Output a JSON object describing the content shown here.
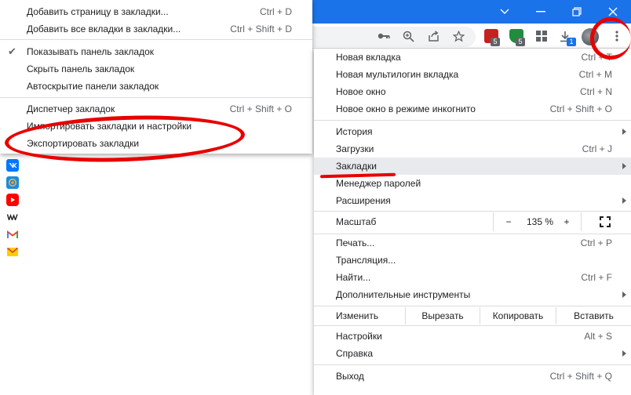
{
  "bookmarks_submenu": {
    "items": [
      {
        "label": "Добавить страницу в закладки...",
        "shortcut": "Ctrl + D"
      },
      {
        "label": "Добавить все вкладки в закладки...",
        "shortcut": "Ctrl + Shift + D"
      },
      {
        "label": "Показывать панель закладок",
        "shortcut": "",
        "checked": true
      },
      {
        "label": "Скрыть панель закладок",
        "shortcut": ""
      },
      {
        "label": "Автоскрытие панели закладок",
        "shortcut": ""
      },
      {
        "label": "Диспетчер закладок",
        "shortcut": "Ctrl + Shift + O"
      },
      {
        "label": "Импортировать закладки и настройки",
        "shortcut": ""
      },
      {
        "label": "Экспортировать закладки",
        "shortcut": ""
      }
    ],
    "check_glyph": "✔"
  },
  "bookmark_icons": [
    "vk-icon",
    "mail-ru-icon",
    "youtube-icon",
    "wildberries-icon",
    "gmail-icon",
    "yandex-mail-icon"
  ],
  "extensions": {
    "badge_1": "5",
    "badge_2": "5",
    "badge_3": "1"
  },
  "main_menu": {
    "new_tab": {
      "label": "Новая вкладка",
      "shortcut": "Ctrl + T"
    },
    "new_multilogin": {
      "label": "Новая мультилогин вкладка",
      "shortcut": "Ctrl + M"
    },
    "new_window": {
      "label": "Новое окно",
      "shortcut": "Ctrl + N"
    },
    "incognito": {
      "label": "Новое окно в режиме инкогнито",
      "shortcut": "Ctrl + Shift + O"
    },
    "history": {
      "label": "История",
      "shortcut": ""
    },
    "downloads": {
      "label": "Загрузки",
      "shortcut": "Ctrl + J"
    },
    "bookmarks": {
      "label": "Закладки",
      "shortcut": ""
    },
    "passwords": {
      "label": "Менеджер паролей",
      "shortcut": ""
    },
    "extensions": {
      "label": "Расширения",
      "shortcut": ""
    },
    "zoom": {
      "label": "Масштаб",
      "minus": "−",
      "value": "135 %",
      "plus": "+"
    },
    "print": {
      "label": "Печать...",
      "shortcut": "Ctrl + P"
    },
    "cast": {
      "label": "Трансляция...",
      "shortcut": ""
    },
    "find": {
      "label": "Найти...",
      "shortcut": "Ctrl + F"
    },
    "more_tools": {
      "label": "Дополнительные инструменты",
      "shortcut": ""
    },
    "edit": {
      "label": "Изменить",
      "cut": "Вырезать",
      "copy": "Копировать",
      "paste": "Вставить"
    },
    "settings": {
      "label": "Настройки",
      "shortcut": "Alt + S"
    },
    "help": {
      "label": "Справка",
      "shortcut": ""
    },
    "exit": {
      "label": "Выход",
      "shortcut": "Ctrl + Shift + Q"
    }
  },
  "colors": {
    "titlebar": "#1a73e8",
    "annotation": "#e80000",
    "highlight": "#e8eaed"
  }
}
